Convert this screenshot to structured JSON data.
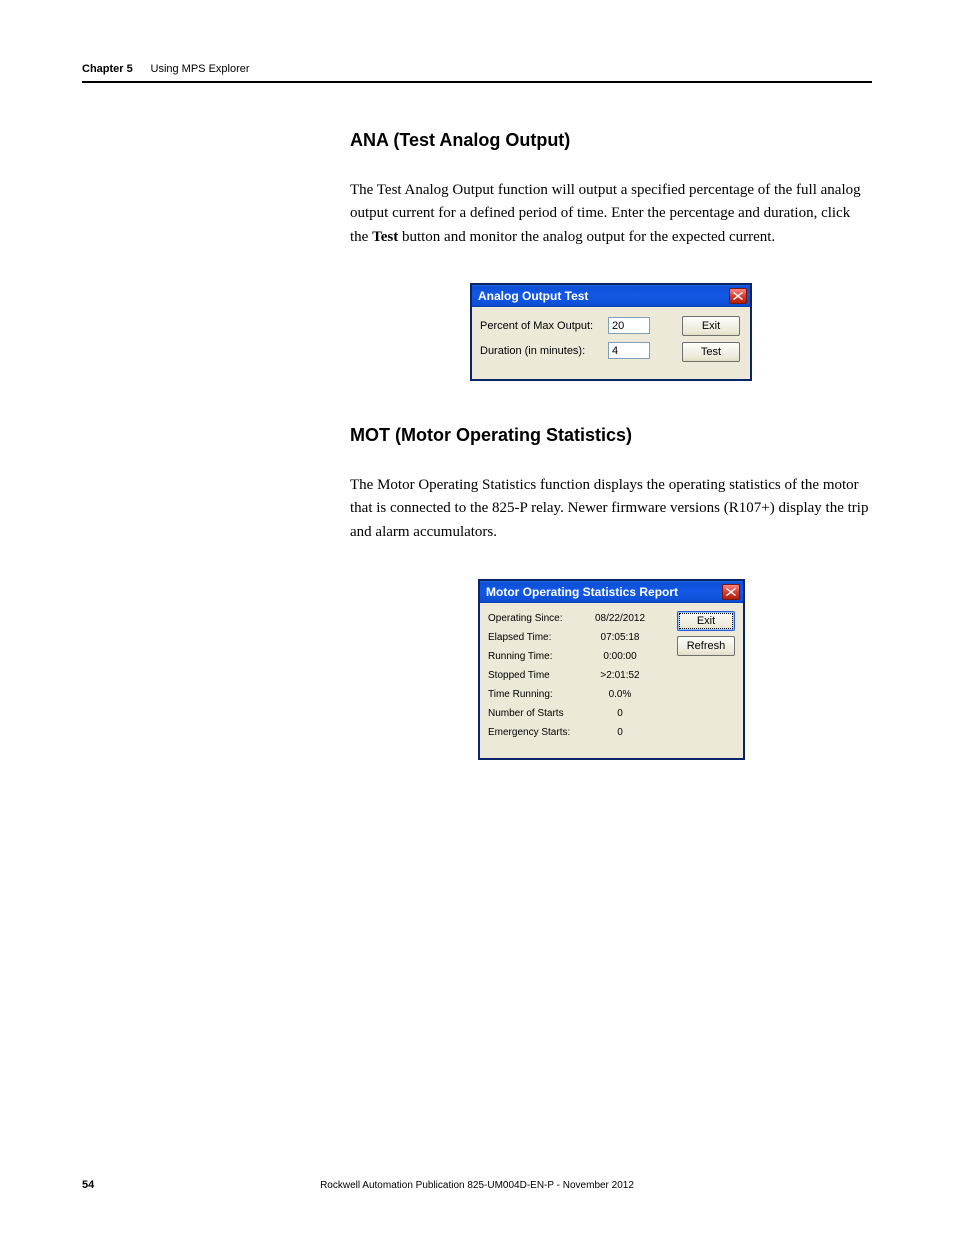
{
  "header": {
    "chapter": "Chapter 5",
    "title": "Using MPS Explorer"
  },
  "section_ana": {
    "heading": "ANA (Test Analog Output)",
    "body_pre": "The Test Analog Output function will output a specified percentage of the full analog output current for a defined period of time. Enter the percentage and duration, click the ",
    "body_bold": "Test",
    "body_post": " button and monitor the analog output for the expected current."
  },
  "dialog_ana": {
    "title": "Analog Output Test",
    "percent_label": "Percent of Max Output:",
    "percent_value": "20",
    "duration_label": "Duration (in minutes):",
    "duration_value": "4",
    "exit_btn": "Exit",
    "test_btn": "Test"
  },
  "section_mot": {
    "heading": "MOT (Motor Operating Statistics)",
    "body": "The Motor Operating Statistics function displays the operating statistics of the motor that is connected to the 825-P relay. Newer firmware versions (R107+) display the trip and alarm accumulators."
  },
  "dialog_mot": {
    "title": "Motor Operating Statistics Report",
    "rows": [
      {
        "label": "Operating Since:",
        "value": "08/22/2012"
      },
      {
        "label": "Elapsed Time:",
        "value": "07:05:18"
      },
      {
        "label": "Running Time:",
        "value": "0:00:00"
      },
      {
        "label": "Stopped Time",
        "value": ">2:01:52"
      },
      {
        "label": "Time Running:",
        "value": "0.0%"
      },
      {
        "label": "Number of Starts",
        "value": "0"
      },
      {
        "label": "Emergency Starts:",
        "value": "0"
      }
    ],
    "exit_btn": "Exit",
    "refresh_btn": "Refresh"
  },
  "footer": {
    "text": "Rockwell Automation Publication 825-UM004D-EN-P - November 2012",
    "page": "54"
  }
}
